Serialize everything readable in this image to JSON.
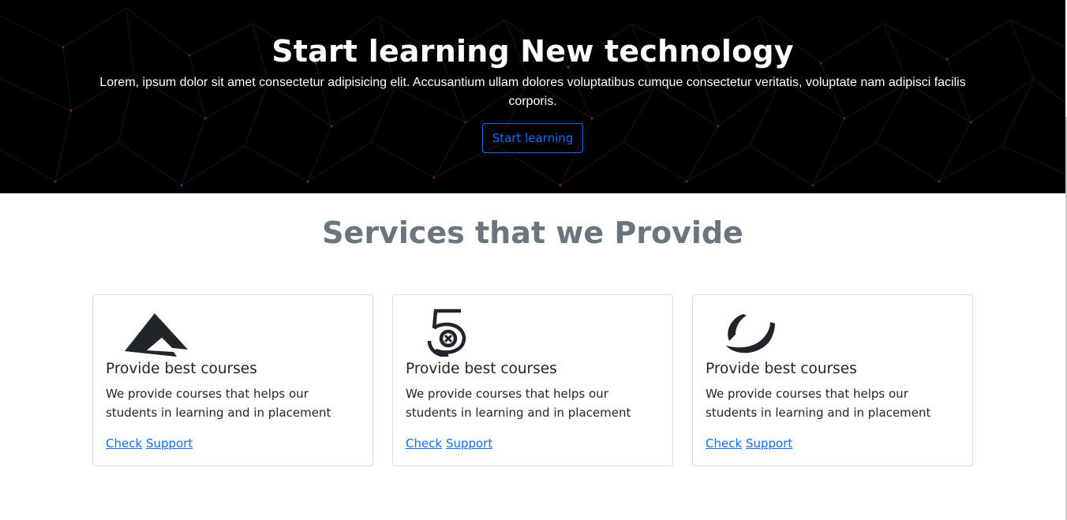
{
  "hero": {
    "title": "Start learning New technology",
    "text": "Lorem, ipsum dolor sit amet consectetur adipisicing elit. Accusantium ullam dolores voluptatibus cumque consectetur veritatis, voluptate nam adipisci facilis corporis.",
    "button_label": "Start learning"
  },
  "services": {
    "title": "Services that we Provide",
    "cards": [
      {
        "icon": "arrow-logo-icon",
        "title": "Provide best courses",
        "text": "We provide courses that helps our students in learning and in placement",
        "link1": "Check",
        "link2": "Support"
      },
      {
        "icon": "five-hundred-px-icon",
        "title": "Provide best courses",
        "text": "We provide courses that helps our students in learning and in placement",
        "link1": "Check",
        "link2": "Support"
      },
      {
        "icon": "wave-logo-icon",
        "title": "Provide best courses",
        "text": "We provide courses that helps our students in learning and in placement",
        "link1": "Check",
        "link2": "Support"
      }
    ]
  },
  "colors": {
    "hero_bg": "#000000",
    "primary": "#0d6efd",
    "muted_heading": "#6c757d"
  }
}
